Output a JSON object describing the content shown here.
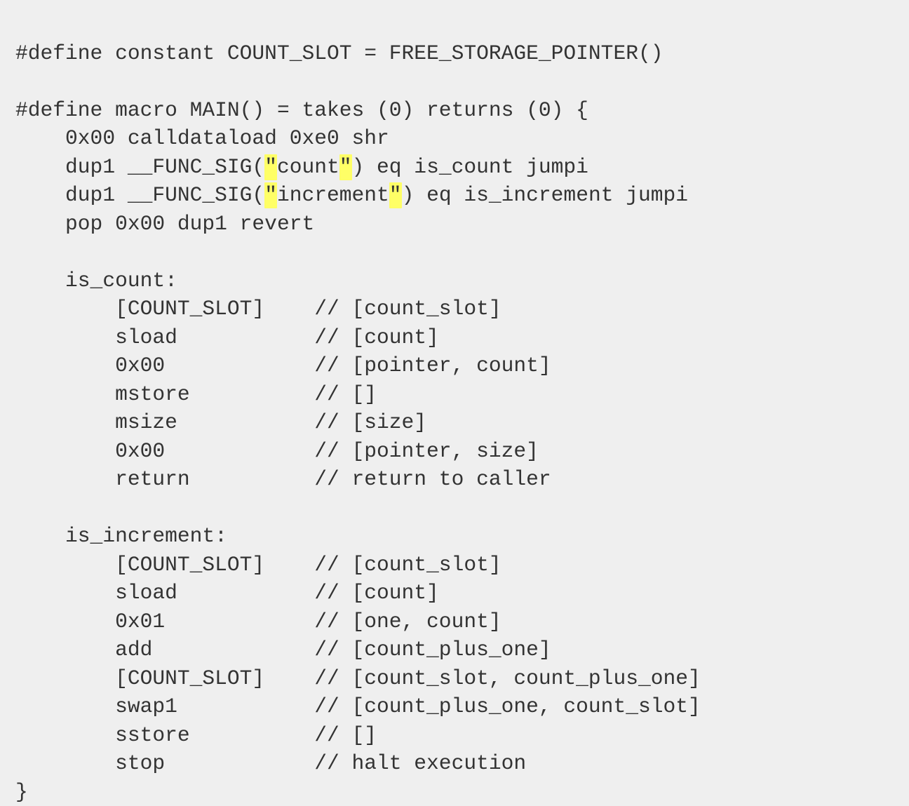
{
  "document": {
    "kind": "source-code-listing",
    "language": "huff",
    "background_color": "#efefef",
    "text_color": "#333333",
    "highlight_color": "#ffff66",
    "highlight_description": "double-quote characters around string literals are highlighted in yellow",
    "font_size_px": 29.6,
    "line_height_px": 40.5,
    "comment_column": 24,
    "lines": [
      {
        "index": 0,
        "segments": [
          {
            "text": "#define constant COUNT_SLOT = FREE_STORAGE_POINTER()",
            "highlight": false
          }
        ]
      },
      {
        "index": 1,
        "blank": true,
        "segments": []
      },
      {
        "index": 2,
        "segments": [
          {
            "text": "#define macro MAIN() = takes (0) returns (0) {",
            "highlight": false
          }
        ]
      },
      {
        "index": 3,
        "segments": [
          {
            "text": "    0x00 calldataload 0xe0 shr",
            "highlight": false
          }
        ]
      },
      {
        "index": 4,
        "segments": [
          {
            "text": "    dup1 __FUNC_SIG(",
            "highlight": false
          },
          {
            "text": "\"",
            "highlight": true
          },
          {
            "text": "count",
            "highlight": false
          },
          {
            "text": "\"",
            "highlight": true
          },
          {
            "text": ") eq is_count jumpi",
            "highlight": false
          }
        ]
      },
      {
        "index": 5,
        "segments": [
          {
            "text": "    dup1 __FUNC_SIG(",
            "highlight": false
          },
          {
            "text": "\"",
            "highlight": true
          },
          {
            "text": "increment",
            "highlight": false
          },
          {
            "text": "\"",
            "highlight": true
          },
          {
            "text": ") eq is_increment jumpi",
            "highlight": false
          }
        ]
      },
      {
        "index": 6,
        "segments": [
          {
            "text": "    pop 0x00 dup1 revert",
            "highlight": false
          }
        ]
      },
      {
        "index": 7,
        "blank": true,
        "segments": []
      },
      {
        "index": 8,
        "segments": [
          {
            "text": "    is_count:",
            "highlight": false
          }
        ]
      },
      {
        "index": 9,
        "segments": [
          {
            "text": "        [COUNT_SLOT]    // [count_slot]",
            "highlight": false
          }
        ]
      },
      {
        "index": 10,
        "segments": [
          {
            "text": "        sload           // [count]",
            "highlight": false
          }
        ]
      },
      {
        "index": 11,
        "segments": [
          {
            "text": "        0x00            // [pointer, count]",
            "highlight": false
          }
        ]
      },
      {
        "index": 12,
        "segments": [
          {
            "text": "        mstore          // []",
            "highlight": false
          }
        ]
      },
      {
        "index": 13,
        "segments": [
          {
            "text": "        msize           // [size]",
            "highlight": false
          }
        ]
      },
      {
        "index": 14,
        "segments": [
          {
            "text": "        0x00            // [pointer, size]",
            "highlight": false
          }
        ]
      },
      {
        "index": 15,
        "segments": [
          {
            "text": "        return          // return to caller",
            "highlight": false
          }
        ]
      },
      {
        "index": 16,
        "blank": true,
        "segments": []
      },
      {
        "index": 17,
        "segments": [
          {
            "text": "    is_increment:",
            "highlight": false
          }
        ]
      },
      {
        "index": 18,
        "segments": [
          {
            "text": "        [COUNT_SLOT]    // [count_slot]",
            "highlight": false
          }
        ]
      },
      {
        "index": 19,
        "segments": [
          {
            "text": "        sload           // [count]",
            "highlight": false
          }
        ]
      },
      {
        "index": 20,
        "segments": [
          {
            "text": "        0x01            // [one, count]",
            "highlight": false
          }
        ]
      },
      {
        "index": 21,
        "segments": [
          {
            "text": "        add             // [count_plus_one]",
            "highlight": false
          }
        ]
      },
      {
        "index": 22,
        "segments": [
          {
            "text": "        [COUNT_SLOT]    // [count_slot, count_plus_one]",
            "highlight": false
          }
        ]
      },
      {
        "index": 23,
        "segments": [
          {
            "text": "        swap1           // [count_plus_one, count_slot]",
            "highlight": false
          }
        ]
      },
      {
        "index": 24,
        "segments": [
          {
            "text": "        sstore          // []",
            "highlight": false
          }
        ]
      },
      {
        "index": 25,
        "segments": [
          {
            "text": "        stop            // halt execution",
            "highlight": false
          }
        ]
      },
      {
        "index": 26,
        "segments": [
          {
            "text": "}",
            "highlight": false
          }
        ]
      }
    ]
  }
}
